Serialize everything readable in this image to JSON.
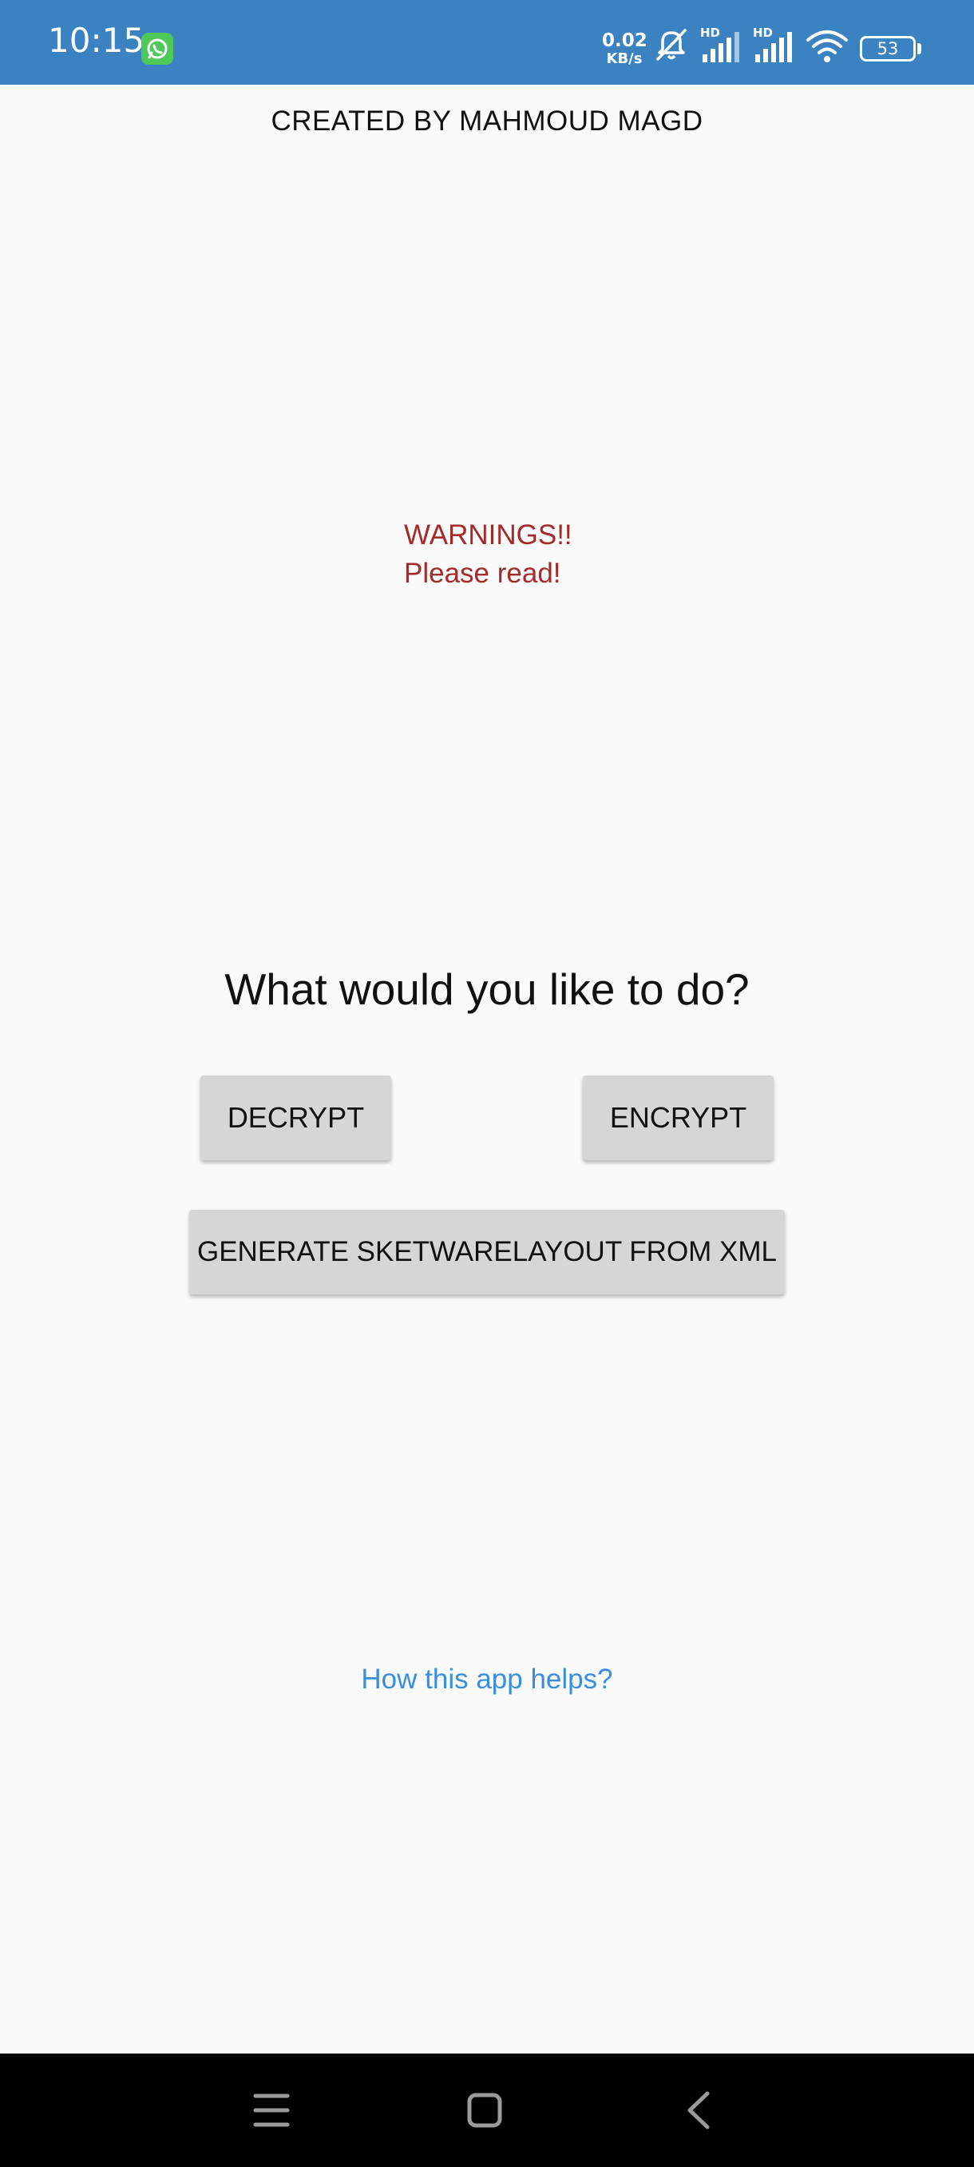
{
  "status_bar": {
    "time": "10:15",
    "notification_icon": "whatsapp-icon",
    "net_speed_value": "0.02",
    "net_speed_unit": "KB/s",
    "battery_level": "53",
    "icons": [
      "mute-icon",
      "signal-hd-icon",
      "signal-hd-icon",
      "wifi-icon",
      "battery-icon"
    ],
    "background_color": "#3a82c2"
  },
  "header": {
    "creator_text": "CREATED BY MAHMOUD MAGD"
  },
  "warning": {
    "line1": "WARNINGS!!",
    "line2": "Please read!",
    "color": "#a52a2a"
  },
  "main": {
    "question": "What would you like to do?",
    "decrypt_label": "DECRYPT",
    "encrypt_label": "ENCRYPT",
    "generate_label": "GENERATE SKETWARELAYOUT FROM XML",
    "help_link": "How this app helps?",
    "link_color": "#3a8ee0"
  },
  "nav_bar": {
    "buttons": [
      "menu-icon",
      "home-icon",
      "back-icon"
    ]
  }
}
